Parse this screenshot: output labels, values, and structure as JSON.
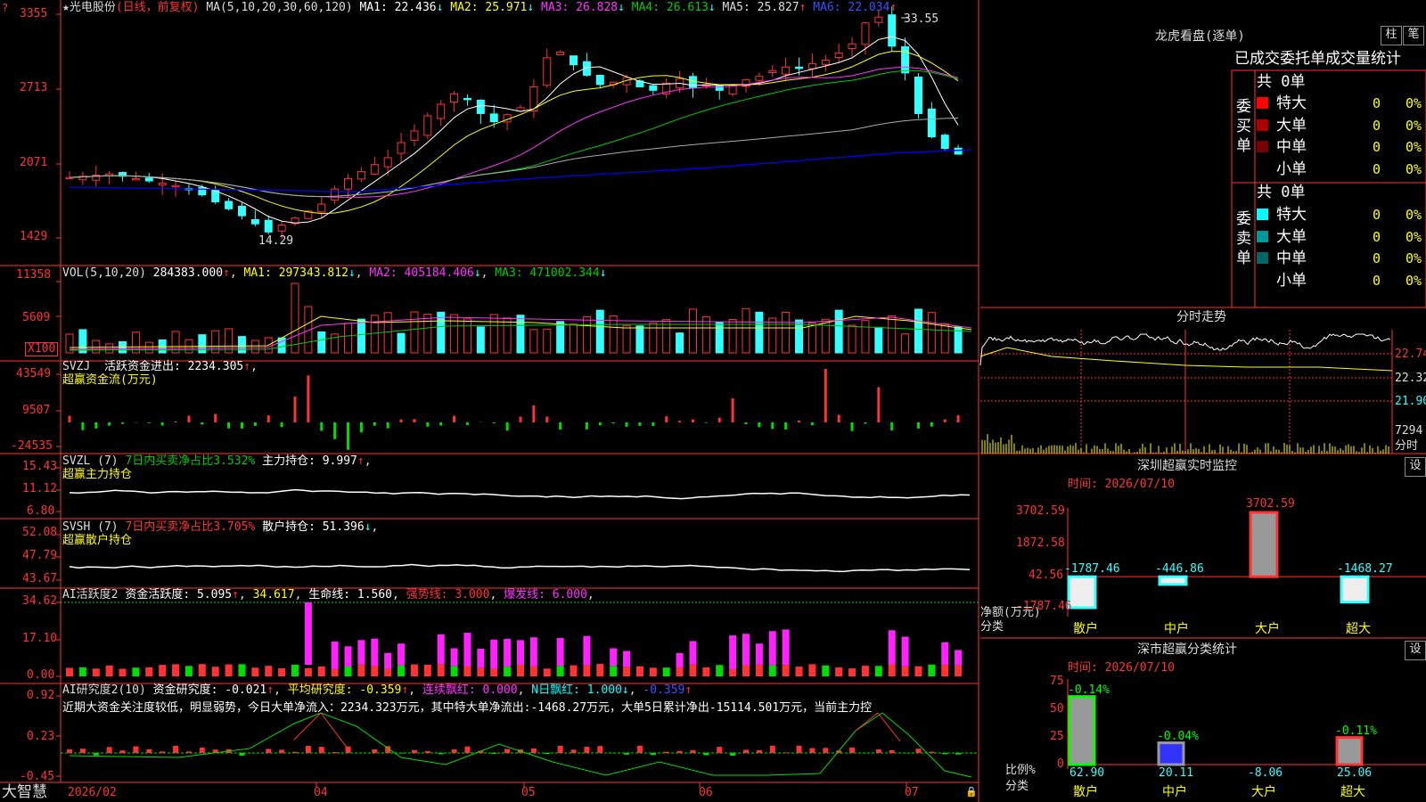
{
  "colors": {
    "up": "#ff3333",
    "down": "#33ffff",
    "grid": "#aa0000",
    "axis": "#ff3333",
    "ma1": "#ffffff",
    "ma2": "#ffff00",
    "ma3": "#ff33ff",
    "ma4": "#00cc00",
    "ma5": "#aaaaaa",
    "ma6": "#0000ff",
    "green": "#00dd00",
    "magenta": "#ff22ff",
    "yellow": "#ffff00",
    "cyan": "#00ffff"
  },
  "main": {
    "title": "★光电股份",
    "mode": "(日线，前复权)",
    "ma_label": "MA(5,10,20,30,60,120)",
    "ma": [
      {
        "label": "MA1: 22.436",
        "arrow": "↓"
      },
      {
        "label": "MA2: 25.971",
        "arrow": "↓"
      },
      {
        "label": "MA3: 26.828",
        "arrow": "↓"
      },
      {
        "label": "MA4: 26.613",
        "arrow": "↓"
      },
      {
        "label": "MA5: 25.827",
        "arrow": "↑"
      },
      {
        "label": "MA6: 22.034",
        "arrow": "↑"
      }
    ],
    "y_ticks": [
      "3355",
      "2713",
      "2071",
      "1429"
    ],
    "high_label": "33.55",
    "low_label": "14.29"
  },
  "vol": {
    "header": "VOL(5,10,20)",
    "value": "284383.000",
    "ma1": "MA1: 297343.812",
    "ma2": "MA2: 405184.406",
    "ma3": "MA3: 471002.344",
    "y_ticks": [
      "11358",
      "5609"
    ],
    "unit": "X100"
  },
  "svzj": {
    "header": "SVZJ",
    "line1": "活跃资金进出: 2234.305",
    "line2": "超赢资金流(万元)",
    "y_ticks": [
      "43549",
      "9507",
      "-24535"
    ]
  },
  "svzl": {
    "header": "SVZL (7)",
    "desc": "7日内买卖净占比3.532%",
    "value": "主力持仓: 9.997",
    "line2": "超赢主力持仓",
    "y_ticks": [
      "15.43",
      "11.12",
      "6.80"
    ]
  },
  "svsh": {
    "header": "SVSH (7)",
    "desc": "7日内买卖净占比3.705%",
    "value": "散户持仓: 51.396",
    "line2": "超赢散户持仓",
    "y_ticks": [
      "52.08",
      "47.79",
      "43.67"
    ]
  },
  "ai1": {
    "header": "AI活跃度2",
    "v1": "资金活跃度: 5.095",
    "v2": "34.617",
    "v3": "生命线: 1.560",
    "v4": "强势线: 3.000",
    "v5": "爆发线: 6.000",
    "y_ticks": [
      "34.62",
      "17.10",
      "0.00"
    ]
  },
  "ai2": {
    "header": "AI研究度2(10)",
    "v1": "资金研究度: -0.021",
    "v2": "平均研究度: -0.359",
    "v3": "连续飘红: 0.000",
    "v4": "N日飘红: 1.000",
    "v5": "-0.359",
    "comment": "近期大资金关注度较低，明显弱势，今日大单净流入：2234.323万元，其中特大单净流出:-1468.27万元，大单5日累计净出-15114.501万元，当前主力控",
    "y_ticks": [
      "0.92",
      "0.23",
      "-0.45"
    ]
  },
  "bottom": {
    "brand": "大智慧",
    "dates": [
      "2026/02",
      "04",
      "05",
      "06",
      "07"
    ]
  },
  "lhb": {
    "title": "龙虎看盘(逐单)",
    "btn1": "柱",
    "btn2": "笔",
    "header": "已成交委托单成交量统计",
    "buy_label": "委买单",
    "sell_label": "委卖单",
    "buy_total": "共 0单",
    "sell_total": "共 0单",
    "buy_rows": [
      {
        "name": "特大",
        "val": "0",
        "pct": "0%",
        "color": "#ff0000"
      },
      {
        "name": "大单",
        "val": "0",
        "pct": "0%",
        "color": "#aa0000"
      },
      {
        "name": "中单",
        "val": "0",
        "pct": "0%",
        "color": "#770000"
      },
      {
        "name": "小单",
        "val": "0",
        "pct": "0%",
        "color": ""
      }
    ],
    "sell_rows": [
      {
        "name": "特大",
        "val": "0",
        "pct": "0%",
        "color": "#00ffff"
      },
      {
        "name": "大单",
        "val": "0",
        "pct": "0%",
        "color": "#009999"
      },
      {
        "name": "中单",
        "val": "0",
        "pct": "0%",
        "color": "#006666"
      },
      {
        "name": "小单",
        "val": "0",
        "pct": "0%",
        "color": ""
      }
    ]
  },
  "fenshi": {
    "title": "分时走势",
    "y_ticks": [
      "22.74",
      "22.32",
      "21.90"
    ],
    "vol_tick": "7294",
    "vol_label": "分时"
  },
  "sz_monitor": {
    "title": "深圳超赢实时监控",
    "btn": "设",
    "time": "时间: 2026/07/10",
    "y_ticks": [
      "3702.59",
      "1872.58",
      "42.56",
      "-1787.46"
    ],
    "y_label1": "净额(万元)",
    "y_label2": "分类",
    "bars": [
      {
        "cat": "散户",
        "value": -1787.46,
        "label": "-1787.46"
      },
      {
        "cat": "中户",
        "value": -446.86,
        "label": "-446.86"
      },
      {
        "cat": "大户",
        "value": 3702.59,
        "label": "3702.59"
      },
      {
        "cat": "超大",
        "value": -1468.27,
        "label": "-1468.27"
      }
    ]
  },
  "sz_class": {
    "title": "深市超赢分类统计",
    "btn": "设",
    "time": "时间: 2026/07/10",
    "y_ticks": [
      "75",
      "50",
      "25",
      "0"
    ],
    "y_label1": "比例%",
    "y_label2": "分类",
    "bars": [
      {
        "cat": "散户",
        "value": 62.9,
        "label": "62.90",
        "top": "-0.14%"
      },
      {
        "cat": "中户",
        "value": 20.11,
        "label": "20.11",
        "top": "-0.04%"
      },
      {
        "cat": "大户",
        "value": -8.06,
        "label": "-8.06",
        "top": ""
      },
      {
        "cat": "超大",
        "value": 25.06,
        "label": "25.06",
        "top": "-0.11%"
      }
    ]
  }
}
